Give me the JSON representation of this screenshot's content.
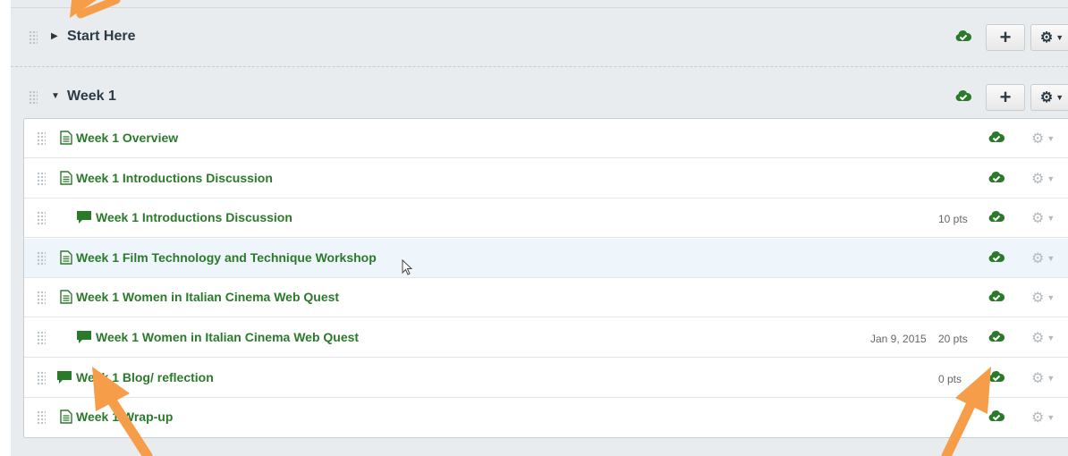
{
  "modules": [
    {
      "title": "Start Here",
      "expanded": false,
      "add_label": "+",
      "icons": {
        "drag": "drag-handle-icon",
        "caret": "caret-right-icon",
        "published": "cloud-check-icon",
        "settings": "gear-icon"
      }
    },
    {
      "title": "Week 1",
      "expanded": true,
      "add_label": "+",
      "icons": {
        "drag": "drag-handle-icon",
        "caret": "caret-down-icon",
        "published": "cloud-check-icon",
        "settings": "gear-icon"
      }
    }
  ],
  "items": [
    {
      "title": "Week 1 Overview",
      "type": "page",
      "indent": false,
      "date": "",
      "points": ""
    },
    {
      "title": "Week 1 Introductions Discussion",
      "type": "page",
      "indent": false,
      "date": "",
      "points": ""
    },
    {
      "title": "Week 1 Introductions Discussion",
      "type": "discussion",
      "indent": true,
      "date": "",
      "points": "10 pts"
    },
    {
      "title": "Week 1 Film Technology and Technique Workshop",
      "type": "page",
      "indent": false,
      "date": "",
      "points": "",
      "highlighted": true
    },
    {
      "title": "Week 1 Women in Italian Cinema Web Quest",
      "type": "page",
      "indent": false,
      "date": "",
      "points": ""
    },
    {
      "title": "Week 1 Women in Italian Cinema Web Quest",
      "type": "discussion",
      "indent": true,
      "date": "Jan 9, 2015",
      "points": "20 pts"
    },
    {
      "title": "Week 1 Blog/ reflection",
      "type": "discussion",
      "indent": false,
      "date": "",
      "points": "0 pts"
    },
    {
      "title": "Week 1 Wrap-up",
      "type": "page",
      "indent": false,
      "date": "",
      "points": ""
    }
  ],
  "colors": {
    "published_green": "#2b7a2b",
    "annotation_orange": "#f59d49",
    "highlight_row": "#eef5fb"
  }
}
